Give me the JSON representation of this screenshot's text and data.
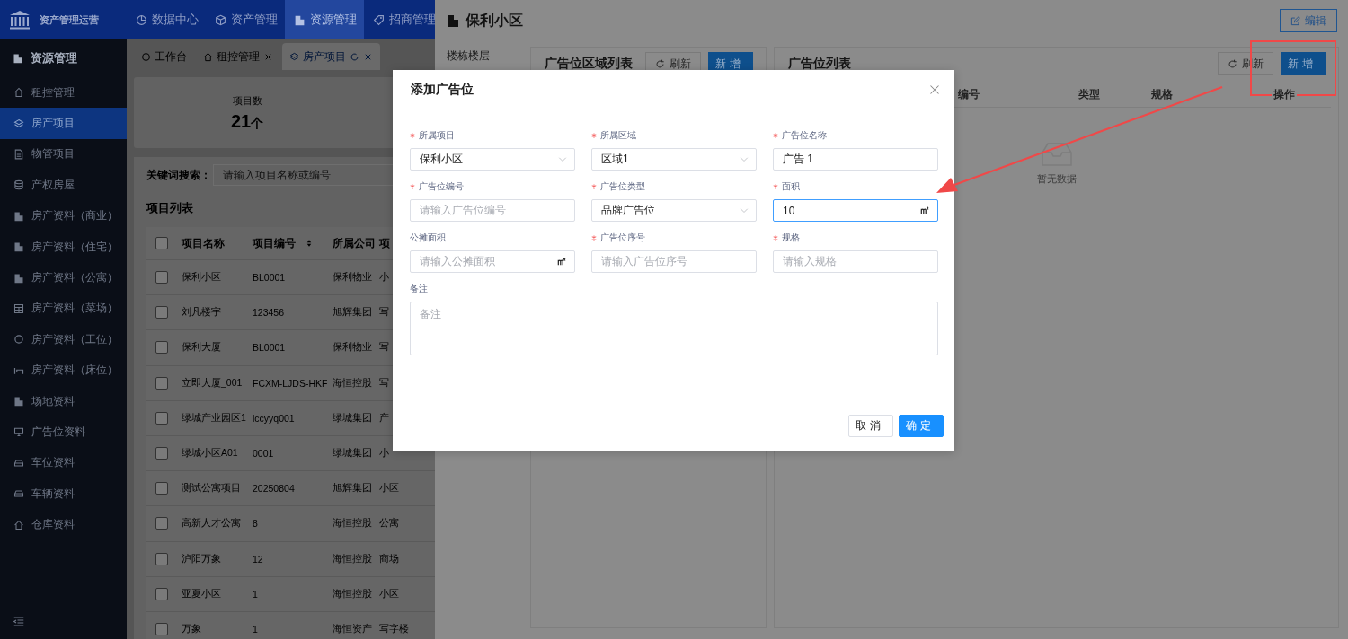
{
  "topbar": {
    "brand": "资产管理运营",
    "nav": [
      {
        "label": "数据中心",
        "selected": false
      },
      {
        "label": "资产管理",
        "selected": false
      },
      {
        "label": "资源管理",
        "selected": true
      },
      {
        "label": "招商管理",
        "selected": false
      }
    ]
  },
  "sidebar": {
    "title": "资源管理",
    "items": [
      {
        "label": "租控管理",
        "selected": false
      },
      {
        "label": "房产项目",
        "selected": true
      },
      {
        "label": "物管项目",
        "selected": false
      },
      {
        "label": "产权房屋",
        "selected": false
      },
      {
        "label": "房产资料（商业）",
        "selected": false
      },
      {
        "label": "房产资料（住宅）",
        "selected": false
      },
      {
        "label": "房产资料（公寓）",
        "selected": false
      },
      {
        "label": "房产资料（菜场）",
        "selected": false
      },
      {
        "label": "房产资料（工位）",
        "selected": false
      },
      {
        "label": "房产资料（床位）",
        "selected": false
      },
      {
        "label": "场地资料",
        "selected": false
      },
      {
        "label": "广告位资料",
        "selected": false
      },
      {
        "label": "车位资料",
        "selected": false
      },
      {
        "label": "车辆资料",
        "selected": false
      },
      {
        "label": "仓库资料",
        "selected": false
      }
    ]
  },
  "tabs": [
    {
      "label": "工作台",
      "selected": false,
      "closable": false
    },
    {
      "label": "租控管理",
      "selected": false,
      "closable": true
    },
    {
      "label": "房产项目",
      "selected": true,
      "closable": true
    }
  ],
  "stats": {
    "label": "项目数",
    "value": "21",
    "unit": "个"
  },
  "search": {
    "label": "关键词搜索：",
    "placeholder": "请输入项目名称或编号"
  },
  "project_list": {
    "title": "项目列表",
    "all_checked": false,
    "columns": [
      "项目名称",
      "项目编号",
      "所属公司",
      "项"
    ],
    "rows": [
      {
        "checked": false,
        "cells": [
          "保利小区",
          "BL0001",
          "保利物业",
          "小"
        ]
      },
      {
        "checked": false,
        "cells": [
          "刘凡楼宇",
          "123456",
          "旭辉集团",
          "写"
        ]
      },
      {
        "checked": false,
        "cells": [
          "保利大厦",
          "BL0001",
          "保利物业",
          "写"
        ]
      },
      {
        "checked": false,
        "cells": [
          "立即大厦_001",
          "FCXM-LJDS-HKF",
          "海恒控股",
          "写"
        ]
      },
      {
        "checked": false,
        "cells": [
          "绿城产业园区1",
          "lccyyq001",
          "绿城集团",
          "产"
        ]
      },
      {
        "checked": false,
        "cells": [
          "绿城小区A01",
          "0001",
          "绿城集团",
          "小"
        ]
      },
      {
        "checked": false,
        "cells": [
          "测试公寓项目",
          "20250804",
          "旭辉集团",
          "小区"
        ]
      },
      {
        "checked": false,
        "cells": [
          "高新人才公寓",
          "8",
          "海恒控股",
          "公寓"
        ]
      },
      {
        "checked": false,
        "cells": [
          "泸阳万象",
          "12",
          "海恒控股",
          "商场"
        ]
      },
      {
        "checked": false,
        "cells": [
          "亚夏小区",
          "1",
          "海恒控股",
          "小区"
        ]
      },
      {
        "checked": false,
        "cells": [
          "万象",
          "1",
          "海恒资产",
          "写字楼"
        ]
      }
    ]
  },
  "drawer": {
    "title": "保利小区",
    "edit_button": "编辑",
    "side_menu": [
      "楼栋楼层"
    ],
    "zone_panel": {
      "title": "广告位区域列表",
      "refresh": "刷新",
      "add": "新增"
    },
    "ad_panel": {
      "title": "广告位列表",
      "refresh": "刷新",
      "add": "新增",
      "columns": [
        "编号",
        "类型",
        "规格",
        "操作"
      ],
      "empty_text": "暂无数据"
    }
  },
  "dialog": {
    "title": "添加广告位",
    "fields": [
      {
        "kind": "select",
        "label": "所属项目",
        "required": true,
        "value": "保利小区",
        "focused": false
      },
      {
        "kind": "select",
        "label": "所属区域",
        "required": true,
        "value": "区域1",
        "focused": false
      },
      {
        "kind": "input",
        "label": "广告位名称",
        "required": true,
        "value": "广告 1",
        "focused": false
      },
      {
        "kind": "input",
        "label": "广告位编号",
        "required": true,
        "placeholder": "请输入广告位编号",
        "focused": false
      },
      {
        "kind": "select",
        "label": "广告位类型",
        "required": true,
        "value": "品牌广告位",
        "focused": false
      },
      {
        "kind": "input",
        "label": "面积",
        "required": true,
        "value": "10",
        "suffix": "㎡",
        "focused": true
      },
      {
        "kind": "input",
        "label": "公摊面积",
        "required": false,
        "placeholder": "请输入公摊面积",
        "suffix": "㎡",
        "focused": false
      },
      {
        "kind": "input",
        "label": "广告位序号",
        "required": true,
        "placeholder": "请输入广告位序号",
        "focused": false
      },
      {
        "kind": "input",
        "label": "规格",
        "required": true,
        "placeholder": "请输入规格",
        "focused": false
      },
      {
        "kind": "textarea",
        "label": "备注",
        "required": false,
        "placeholder": "备注",
        "focused": false
      }
    ],
    "buttons": [
      {
        "label": "取消",
        "kind": "default"
      },
      {
        "label": "确定",
        "kind": "primary"
      }
    ]
  }
}
